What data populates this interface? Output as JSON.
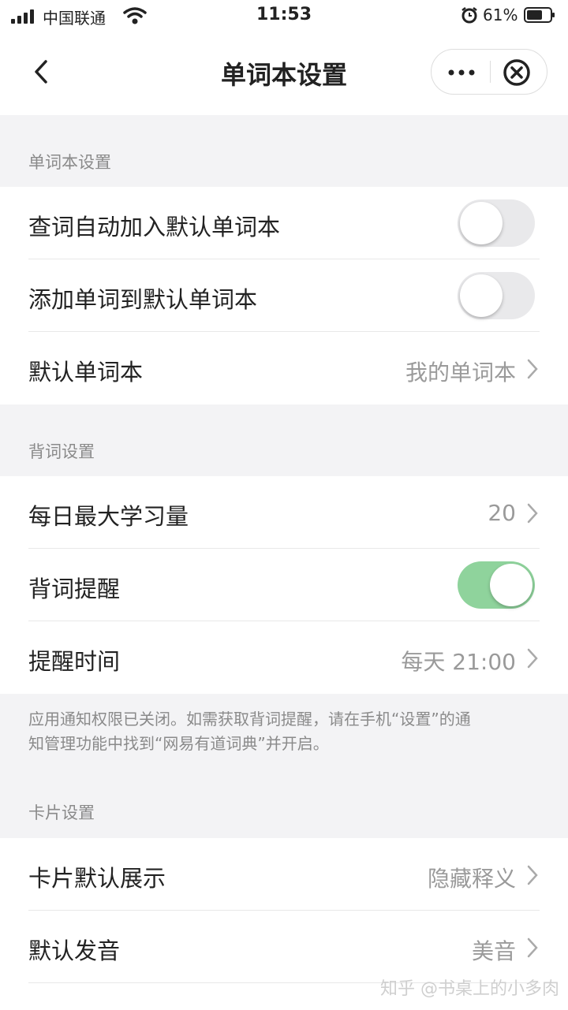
{
  "status_bar": {
    "carrier": "中国联通",
    "time": "11:53",
    "battery": "61%"
  },
  "nav": {
    "title": "单词本设置",
    "icons": [
      "chevron-left-icon",
      "more-icon",
      "close-circle-icon"
    ]
  },
  "sections": {
    "wordbook": {
      "header": "单词本设置",
      "auto_add": {
        "label": "查词自动加入默认单词本",
        "enabled": false
      },
      "add_to_default": {
        "label": "添加单词到默认单词本",
        "enabled": false
      },
      "default_wordbook": {
        "label": "默认单词本",
        "value": "我的单词本"
      }
    },
    "recite": {
      "header": "背词设置",
      "daily_max": {
        "label": "每日最大学习量",
        "value": "20"
      },
      "reminder": {
        "label": "背词提醒",
        "enabled": true
      },
      "reminder_time": {
        "label": "提醒时间",
        "value": "每天 21:00"
      },
      "note_line1": "应用通知权限已关闭。如需获取背词提醒，请在手机“设置”的通",
      "note_line2": "知管理功能中找到“网易有道词典”并开启。"
    },
    "card": {
      "header": "卡片设置",
      "default_display": {
        "label": "卡片默认展示",
        "value": "隐藏释义"
      },
      "default_pronunciation": {
        "label": "默认发音",
        "value": "美音"
      }
    }
  },
  "watermark": "知乎 @书桌上的小多肉",
  "colors": {
    "toggle_on": "#8fd39c",
    "toggle_off": "#e9e9eb",
    "background": "#f3f3f5"
  }
}
